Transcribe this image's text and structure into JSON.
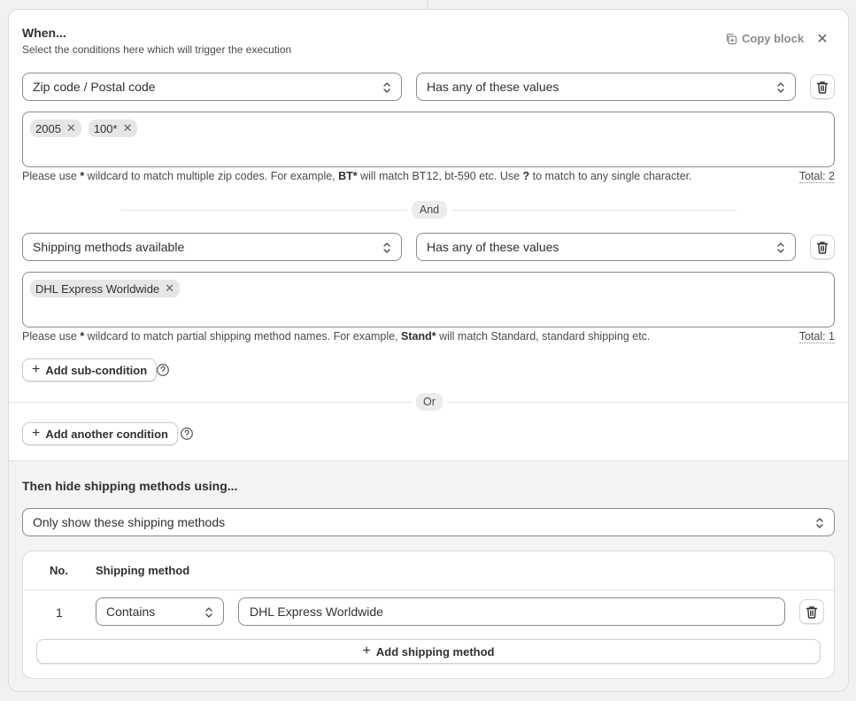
{
  "header": {
    "title": "When...",
    "subtitle": "Select the conditions here which will trigger the execution",
    "copy_label": "Copy block",
    "close_glyph": "✕"
  },
  "condition1": {
    "field": "Zip code / Postal code",
    "operator": "Has any of these values",
    "tags": [
      "2005",
      "100*"
    ],
    "help_pre": "Please use ",
    "help_wild": "*",
    "help_mid": " wildcard to match multiple zip codes. For example, ",
    "help_ex": "BT*",
    "help_mid2": " will match BT12, bt-590 etc. Use ",
    "help_q": "?",
    "help_post": " to match to any single character.",
    "total": "Total: 2"
  },
  "and_label": "And",
  "condition2": {
    "field": "Shipping methods available",
    "operator": "Has any of these values",
    "tags": [
      "DHL Express Worldwide"
    ],
    "help_pre": "Please use ",
    "help_wild": "*",
    "help_mid": " wildcard to match partial shipping method names. For example, ",
    "help_ex": "Stand*",
    "help_post": " will match Standard, standard shipping etc.",
    "total": "Total: 1"
  },
  "add_sub_condition": "Add sub-condition",
  "or_label": "Or",
  "add_another_condition": "Add another condition",
  "action": {
    "title": "Then hide shipping methods using...",
    "mode": "Only show these shipping methods",
    "table": {
      "col_no": "No.",
      "col_method": "Shipping method",
      "rows": [
        {
          "no": "1",
          "match": "Contains",
          "value": "DHL Express Worldwide"
        }
      ]
    },
    "add_method": "Add shipping method"
  },
  "icons": {
    "copy": "copy-icon",
    "close": "close-icon",
    "chevron": "select-chevron-icon",
    "trash": "trash-icon",
    "help": "question-circle-icon",
    "plus": "plus-icon"
  }
}
